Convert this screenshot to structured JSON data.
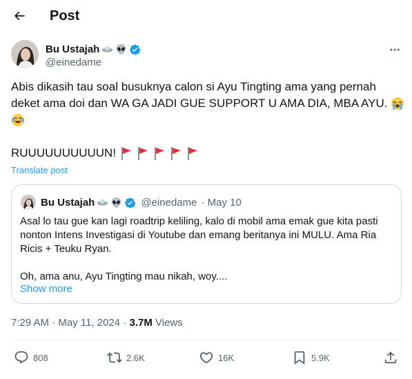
{
  "header": {
    "title": "Post",
    "back_icon": "arrow-left-icon"
  },
  "post": {
    "author_name": "Bu Ustajah",
    "author_handle": "@einedame",
    "name_emojis": [
      "ufo-icon",
      "alien-icon"
    ],
    "verified_icon": "verified-badge-icon",
    "more_icon": "more-horizontal-icon",
    "text_line1": "Abis dikasih tau soal busuknya calon si Ayu Tingting ama yang pernah",
    "text_line2": "deket ama doi dan WA GA JADI GUE SUPPORT U AMA DIA, MBA AYU.",
    "text_line2_emoji": "loudly-crying-face-icon",
    "text_line3_emoji": "face-with-tears-of-joy-icon",
    "text_line4": "RUUUUUUUUUUN!",
    "flag_icons": [
      "red-flag-icon",
      "red-flag-icon",
      "red-flag-icon",
      "red-flag-icon",
      "red-flag-icon"
    ],
    "translate_label": "Translate post"
  },
  "quote": {
    "author_name": "Bu Ustajah",
    "author_handle": "@einedame",
    "date": "· May 10",
    "line1": "Asal lo tau gue kan lagi roadtrip keliling, kalo di mobil ama emak gue kita pasti",
    "line2": "nonton Intens Investigasi di Youtube dan emang beritanya ini MULU. Ama Ria",
    "line3": "Ricis + Teuku Ryan.",
    "line4": "Oh, ama anu, Ayu Tingting mau nikah, woy....",
    "show_more": "Show more"
  },
  "meta": {
    "timestamp": "7:29 AM · May 11, 2024 · ",
    "views_count": "3.7M",
    "views_label": " Views"
  },
  "actions": {
    "replies": "808",
    "reposts": "2.6K",
    "likes": "16K",
    "bookmarks": "5.9K"
  },
  "colors": {
    "accent": "#1d9bf0",
    "secondary_text": "#536471",
    "border": "#cfd9de",
    "verified": "#1d9bf0",
    "flag": "#e0303a"
  }
}
